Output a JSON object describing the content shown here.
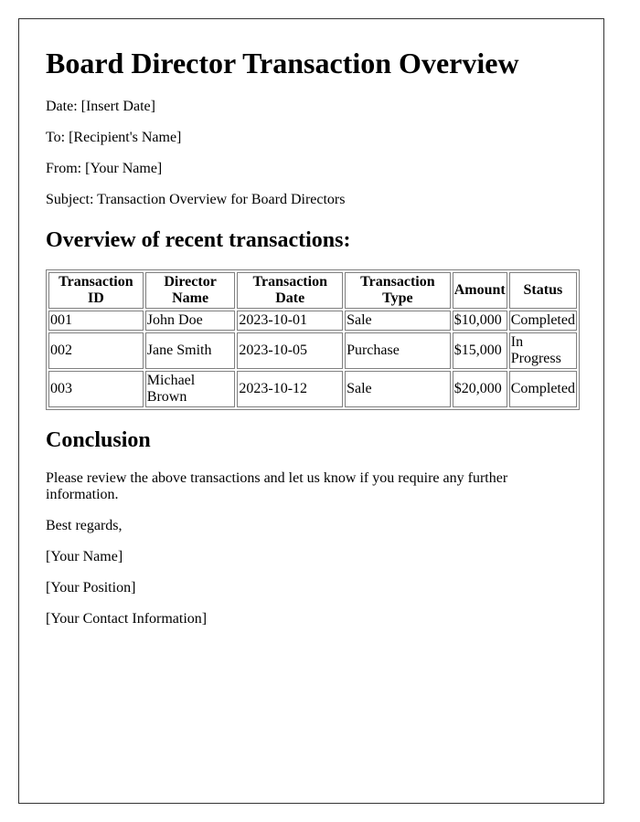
{
  "document": {
    "title": "Board Director Transaction Overview",
    "meta": {
      "date": "Date: [Insert Date]",
      "to": "To: [Recipient's Name]",
      "from": "From: [Your Name]",
      "subject": "Subject: Transaction Overview for Board Directors"
    },
    "overview_heading": "Overview of recent transactions:",
    "table": {
      "headers": [
        "Transaction ID",
        "Director Name",
        "Transaction Date",
        "Transaction Type",
        "Amount",
        "Status"
      ],
      "rows": [
        [
          "001",
          "John Doe",
          "2023-10-01",
          "Sale",
          "$10,000",
          "Completed"
        ],
        [
          "002",
          "Jane Smith",
          "2023-10-05",
          "Purchase",
          "$15,000",
          "In Progress"
        ],
        [
          "003",
          "Michael Brown",
          "2023-10-12",
          "Sale",
          "$20,000",
          "Completed"
        ]
      ]
    },
    "conclusion_heading": "Conclusion",
    "conclusion_text": "Please review the above transactions and let us know if you require any further information.",
    "closing": "Best regards,",
    "signature": {
      "name": "[Your Name]",
      "position": "[Your Position]",
      "contact": "[Your Contact Information]"
    }
  }
}
